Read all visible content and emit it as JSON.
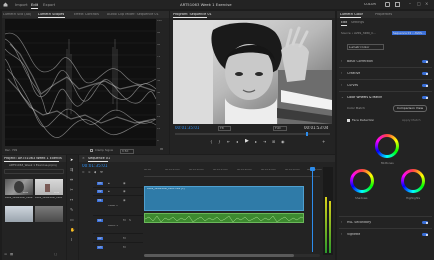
{
  "app": {
    "menu": [
      "Import",
      "Edit",
      "Export"
    ],
    "active_menu": "Edit",
    "window_title": "ART51063 Week 1 Exercise",
    "right_status": "COLOR"
  },
  "scopes": {
    "tabs": [
      "Lumetri Scopes",
      "Effect Controls",
      "Audio Clip Mixer: Sequence 01"
    ],
    "active_tab": "Lumetri Scopes",
    "clamp_label": "Clamp Signal",
    "bit_label": "8 Bit",
    "rec_label": "Rec. 709",
    "scale_right": [
      "100",
      "90",
      "80",
      "70",
      "60",
      "50",
      "40",
      "30",
      "20",
      "10",
      "0"
    ]
  },
  "program": {
    "title": "Program: Sequence 01",
    "timecode_left": "00:01:35:01",
    "fit": "Fit",
    "full": "Full",
    "timecode_right": "00:01:53:04"
  },
  "lumetri": {
    "tabs": [
      "Lumetri Color",
      "Properties"
    ],
    "sub_tabs": [
      "Edit",
      "Settings"
    ],
    "source_label": "Source • AVKS_3280_C...",
    "seq_label": "Sequence 01 • AVKS...",
    "preset_label": "Lumetri Color",
    "sections": [
      "Basic Correction",
      "Creative",
      "Curves",
      "Color Wheels & Match",
      "HSL Secondary",
      "Vignette"
    ],
    "color_match_label": "Color Match",
    "comparison_view": "Comparison View",
    "face_detection": "Face Detection",
    "apply_match": "Apply Match",
    "wheel_labels": [
      "Midtones",
      "Shadows",
      "Highlights"
    ],
    "colors": {
      "toggle": "#3a6fd8",
      "accent": "#2d8ceb"
    }
  },
  "project": {
    "tabs": [
      "Project: ART51063 Week 1 Exercise"
    ],
    "path": "ART51063_Week 1 Exercise.prproj",
    "items": [
      {
        "name": "AVKS_3280HDMI_C000...",
        "duration": "0:08"
      },
      {
        "name": "AVKS_3280HDMI_C005",
        "duration": "0:04"
      },
      {
        "name": "",
        "duration": ""
      },
      {
        "name": "",
        "duration": ""
      }
    ]
  },
  "timeline": {
    "tab": "Sequence 01",
    "timecode": "00:01:35:01",
    "ruler": [
      "00:00",
      "00:01:05:00",
      "00:01:10:00",
      "00:01:15:00",
      "00:01:20:00",
      "00:01:25:00",
      "00:01:30:00",
      "00:01:35:00"
    ],
    "tracks": [
      {
        "id": "V3",
        "name": ""
      },
      {
        "id": "V2",
        "name": ""
      },
      {
        "id": "V1",
        "name": "Video 1"
      },
      {
        "id": "A1",
        "name": "Audio 1"
      },
      {
        "id": "A2",
        "name": ""
      },
      {
        "id": "A3",
        "name": ""
      }
    ],
    "clip_name": "AVKS_3280HDMI_C003.mov [V]"
  }
}
